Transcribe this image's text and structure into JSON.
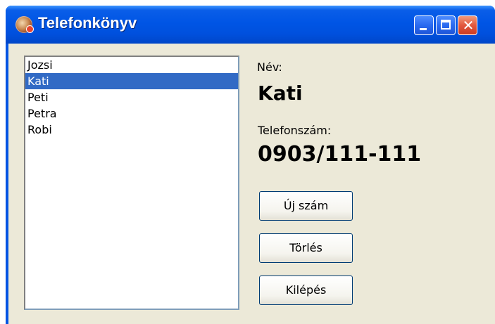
{
  "window": {
    "title": "Telefonkönyv",
    "controls": {
      "minimize_icon": "minimize-icon",
      "maximize_icon": "maximize-icon",
      "close_icon": "close-icon",
      "close_glyph": "✕"
    }
  },
  "list": {
    "items": [
      "Jozsi",
      "Kati",
      "Peti",
      "Petra",
      "Robi"
    ],
    "selected_index": 1
  },
  "detail": {
    "name_label": "Név:",
    "name_value": "Kati",
    "phone_label": "Telefonszám:",
    "phone_value": "0903/111-111"
  },
  "buttons": {
    "new_label": "Új szám",
    "delete_label": "Törlés",
    "exit_label": "Kilépés"
  },
  "colors": {
    "titlebar": "#0055e5",
    "selection": "#316ac5",
    "client_bg": "#ece9d8"
  }
}
